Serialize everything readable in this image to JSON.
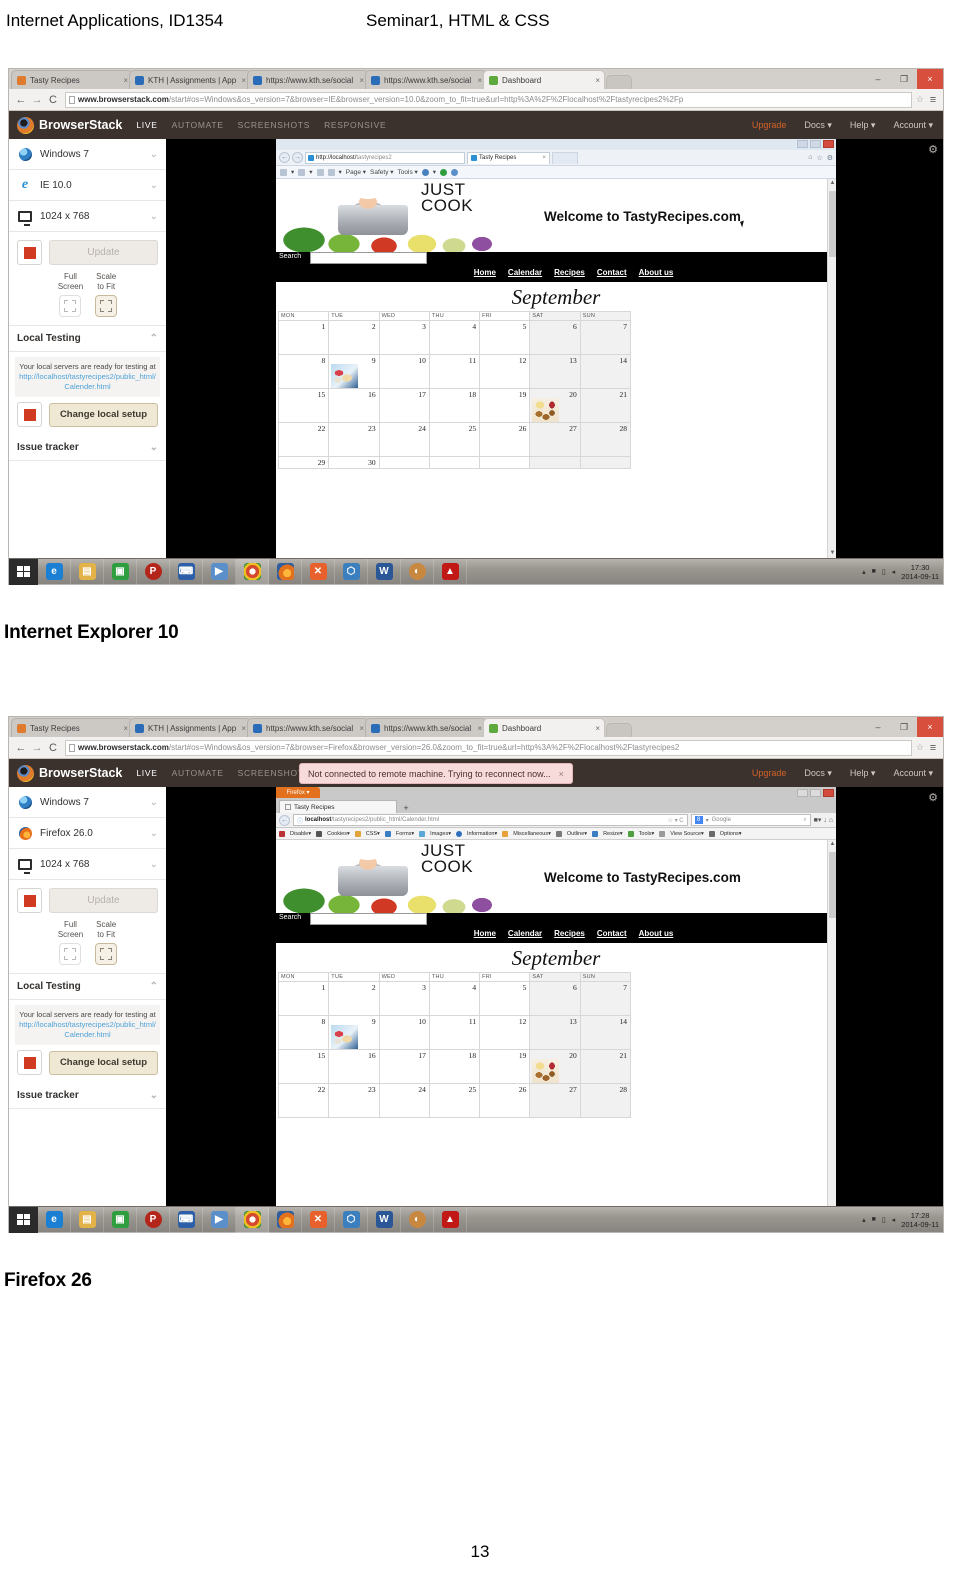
{
  "document": {
    "header_left": "Internet Applications, ID1354",
    "header_right": "Seminar1, HTML & CSS",
    "caption_1": "Internet Explorer 10",
    "caption_2": "Firefox 26",
    "page_number": "13"
  },
  "shot1": {
    "chrome": {
      "tabs": [
        {
          "label": "Tasty Recipes",
          "favicon": "#e07a2f",
          "active": false
        },
        {
          "label": "KTH | Assignments | Appl",
          "favicon": "#2b6cb8",
          "active": false
        },
        {
          "label": "https://www.kth.se/social",
          "favicon": "#2b6cb8",
          "active": false
        },
        {
          "label": "https://www.kth.se/social",
          "favicon": "#2b6cb8",
          "active": false
        },
        {
          "label": "Dashboard",
          "favicon": "#5eaa3f",
          "active": true
        }
      ],
      "close_glyph": "×",
      "window_controls": {
        "minimize": "–",
        "maximize": "❐",
        "close": "×"
      },
      "nav": {
        "back": "←",
        "forward": "→",
        "reload": "C"
      },
      "url_domain": "www.browserstack.com",
      "url_rest": "/start#os=Windows&os_version=7&browser=IE&browser_version=10.0&zoom_to_fit=true&url=http%3A%2F%2Flocalhost%2Ftastyrecipes2%2Fp",
      "star": "☆",
      "menu": "≡"
    },
    "browserstack": {
      "brand": "BrowserStack",
      "nav": [
        {
          "label": "LIVE",
          "active": true
        },
        {
          "label": "AUTOMATE",
          "active": false
        },
        {
          "label": "SCREENSHOTS",
          "active": false
        },
        {
          "label": "RESPONSIVE",
          "active": false
        }
      ],
      "right_nav": [
        {
          "label": "Upgrade",
          "accent": true
        },
        {
          "label": "Docs ▾",
          "accent": false
        },
        {
          "label": "Help ▾",
          "accent": false
        },
        {
          "label": "Account ▾",
          "accent": false
        }
      ],
      "sidebar": {
        "os": "Windows 7",
        "browser": "IE 10.0",
        "resolution": "1024 x 768",
        "update_label": "Update",
        "full_screen_label_1": "Full",
        "full_screen_label_2": "Screen",
        "scale_label_1": "Scale",
        "scale_label_2": "to Fit",
        "local_testing_title": "Local Testing",
        "local_note_text": "Your local servers are ready for testing at",
        "local_note_link": "http://localhost/tastyrecipes2/public_html/Calender.html",
        "change_setup_label": "Change local setup",
        "issue_tracker_title": "Issue tracker",
        "chevron_down": "⌄",
        "chevron_up": "⌃"
      },
      "gear": "⚙"
    },
    "inner": {
      "type": "ie",
      "url_domain": "http://localhost/",
      "url_rest": "tastyrecipes2",
      "tab_title": "Tasty Recipes",
      "cmdbar": [
        "Page ▾",
        "Safety ▾",
        "Tools ▾"
      ]
    },
    "taskbar": {
      "clock_time": "17:30",
      "clock_date": "2014-09-11"
    }
  },
  "shot2": {
    "chrome": {
      "tabs": [
        {
          "label": "Tasty Recipes",
          "favicon": "#e07a2f",
          "active": false
        },
        {
          "label": "KTH | Assignments | Appl",
          "favicon": "#2b6cb8",
          "active": false
        },
        {
          "label": "https://www.kth.se/social",
          "favicon": "#2b6cb8",
          "active": false
        },
        {
          "label": "https://www.kth.se/social",
          "favicon": "#2b6cb8",
          "active": false
        },
        {
          "label": "Dashboard",
          "favicon": "#5eaa3f",
          "active": true
        }
      ],
      "url_domain": "www.browserstack.com",
      "url_rest": "/start#os=Windows&os_version=7&browser=Firefox&browser_version=26.0&zoom_to_fit=true&url=http%3A%2F%2Flocalhost%2Ftastyrecipes2"
    },
    "browserstack": {
      "toast_message": "Not connected to remote machine. Trying to reconnect now...",
      "toast_close": "×",
      "sidebar": {
        "os": "Windows 7",
        "browser": "Firefox 26.0",
        "resolution": "1024 x 768"
      }
    },
    "inner": {
      "type": "firefox",
      "menu_button": "Firefox ▾",
      "tab_title": "Tasty Recipes",
      "new_tab": "+",
      "url_domain": "localhost",
      "url_rest": "/tastyrecipes2/public_html/Calender.html",
      "search_placeholder": "Google",
      "devbar": [
        "Disable▾",
        "Cookies▾",
        "CSS▾",
        "Forms▾",
        "Images▾",
        "Information▾",
        "Miscellaneous▾",
        "Outline▾",
        "Resize▾",
        "Tools▾",
        "View Source▾",
        "Options▾"
      ]
    },
    "taskbar": {
      "clock_time": "17:28",
      "clock_date": "2014-09-11"
    }
  },
  "tastyrecipes": {
    "logo_line1": "JUST",
    "logo_line2": "COOK",
    "welcome": "Welcome to TastyRecipes.com",
    "search_label": "Search",
    "nav": [
      "Home",
      "Calendar",
      "Recipes",
      "Contact",
      "About us"
    ],
    "month": "September",
    "weekday_headers": [
      "MON",
      "TUE",
      "WED",
      "THU",
      "FRI",
      "SAT",
      "SUN"
    ],
    "weeks": [
      [
        {
          "day": "1"
        },
        {
          "day": "2"
        },
        {
          "day": "3"
        },
        {
          "day": "4"
        },
        {
          "day": "5"
        },
        {
          "day": "6",
          "weekend": true
        },
        {
          "day": "7",
          "weekend": true
        }
      ],
      [
        {
          "day": "8"
        },
        {
          "day": "9",
          "image": "food-a"
        },
        {
          "day": "10"
        },
        {
          "day": "11"
        },
        {
          "day": "12"
        },
        {
          "day": "13",
          "weekend": true
        },
        {
          "day": "14",
          "weekend": true
        }
      ],
      [
        {
          "day": "15"
        },
        {
          "day": "16"
        },
        {
          "day": "17"
        },
        {
          "day": "18"
        },
        {
          "day": "19"
        },
        {
          "day": "20",
          "weekend": true,
          "image": "food-b"
        },
        {
          "day": "21",
          "weekend": true
        }
      ],
      [
        {
          "day": "22"
        },
        {
          "day": "23"
        },
        {
          "day": "24"
        },
        {
          "day": "25"
        },
        {
          "day": "26"
        },
        {
          "day": "27",
          "weekend": true
        },
        {
          "day": "28",
          "weekend": true
        }
      ],
      [
        {
          "day": "29"
        },
        {
          "day": "30"
        },
        {
          "day": ""
        },
        {
          "day": ""
        },
        {
          "day": ""
        },
        {
          "day": "",
          "weekend": true
        },
        {
          "day": "",
          "weekend": true
        }
      ]
    ]
  },
  "taskbar_apps": [
    {
      "name": "internet-explorer",
      "glyph": "e",
      "color": "#1b7fd4",
      "boxed": false
    },
    {
      "name": "file-explorer",
      "glyph": "▤",
      "color": "#e3b34a",
      "boxed": false
    },
    {
      "name": "windows-store",
      "glyph": "▣",
      "color": "#2f9e3f",
      "boxed": false
    },
    {
      "name": "powerpoint",
      "glyph": "P",
      "color": "#b4261a",
      "boxed": false
    },
    {
      "name": "remote-desktop",
      "glyph": "⌨",
      "color": "#2c5fa8",
      "boxed": false
    },
    {
      "name": "media-player",
      "glyph": "▶",
      "color": "#5b8fc9",
      "boxed": false
    },
    {
      "name": "google-chrome",
      "glyph": "●",
      "color": "#d6492f",
      "boxed": true
    },
    {
      "name": "firefox",
      "glyph": "●",
      "color": "#e2701c",
      "boxed": false
    },
    {
      "name": "xampp",
      "glyph": "✕",
      "color": "#e8612c",
      "boxed": false
    },
    {
      "name": "virtualbox",
      "glyph": "⬡",
      "color": "#3c7fbf",
      "boxed": false
    },
    {
      "name": "word",
      "glyph": "W",
      "color": "#2b5797",
      "boxed": false
    },
    {
      "name": "paint",
      "glyph": "◐",
      "color": "#c9883f",
      "boxed": false
    },
    {
      "name": "acrobat-reader",
      "glyph": "▲",
      "color": "#c11a16",
      "boxed": false
    }
  ],
  "tray": {
    "arrow": "▴",
    "network": "■",
    "battery": "▯",
    "volume": "◂"
  }
}
